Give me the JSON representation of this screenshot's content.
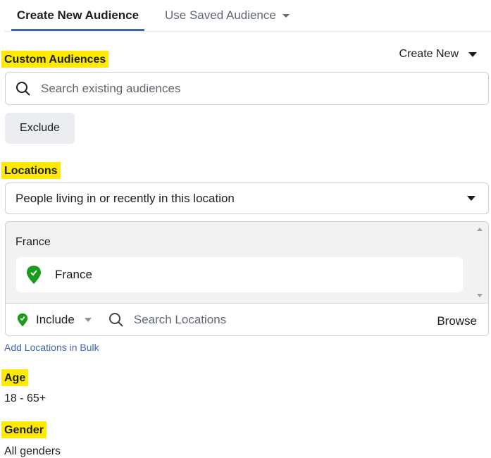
{
  "tabs": [
    {
      "label": "Create New Audience"
    },
    {
      "label": "Use Saved Audience"
    }
  ],
  "custom_audiences": {
    "title": "Custom Audiences",
    "create_new": "Create New",
    "search_placeholder": "Search existing audiences",
    "exclude": "Exclude"
  },
  "locations": {
    "title": "Locations",
    "type_select": "People living in or recently in this location",
    "group_label": "France",
    "selected": [
      {
        "label": "France"
      }
    ],
    "include": "Include",
    "search_placeholder": "Search Locations",
    "browse": "Browse",
    "bulk_link": "Add Locations in Bulk"
  },
  "age": {
    "title": "Age",
    "value": "18 - 65+"
  },
  "gender": {
    "title": "Gender",
    "value": "All genders"
  },
  "colors": {
    "accent": "#4267b2",
    "highlight": "#ffea00",
    "pin": "#1a9c1a"
  }
}
